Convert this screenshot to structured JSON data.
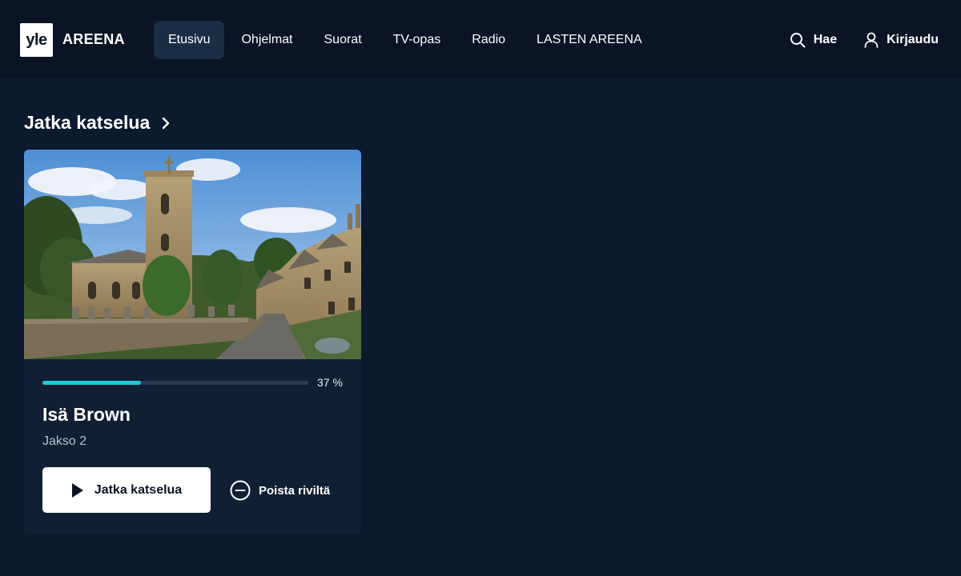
{
  "header": {
    "logo_mark": "yle",
    "logo_text": "AREENA",
    "nav": [
      {
        "label": "Etusivu",
        "active": true
      },
      {
        "label": "Ohjelmat",
        "active": false
      },
      {
        "label": "Suorat",
        "active": false
      },
      {
        "label": "TV-opas",
        "active": false
      },
      {
        "label": "Radio",
        "active": false
      },
      {
        "label": "LASTEN AREENA",
        "active": false
      }
    ],
    "search_label": "Hae",
    "search_icon": "search-icon",
    "login_label": "Kirjaudu",
    "login_icon": "user-icon"
  },
  "section": {
    "title": "Jatka katselua",
    "icon": "chevron-right-icon"
  },
  "card": {
    "progress_fraction": 0.37,
    "progress_label": "37 %",
    "title": "Isä Brown",
    "subtitle": "Jakso 2",
    "play_label": "Jatka katselua",
    "play_icon": "play-icon",
    "remove_label": "Poista riviltä",
    "remove_icon": "minus-circle-icon"
  },
  "colors": {
    "background": "#0c1a2e",
    "header": "#0a1424",
    "card": "#101f33",
    "accent": "#1fc8d6"
  }
}
